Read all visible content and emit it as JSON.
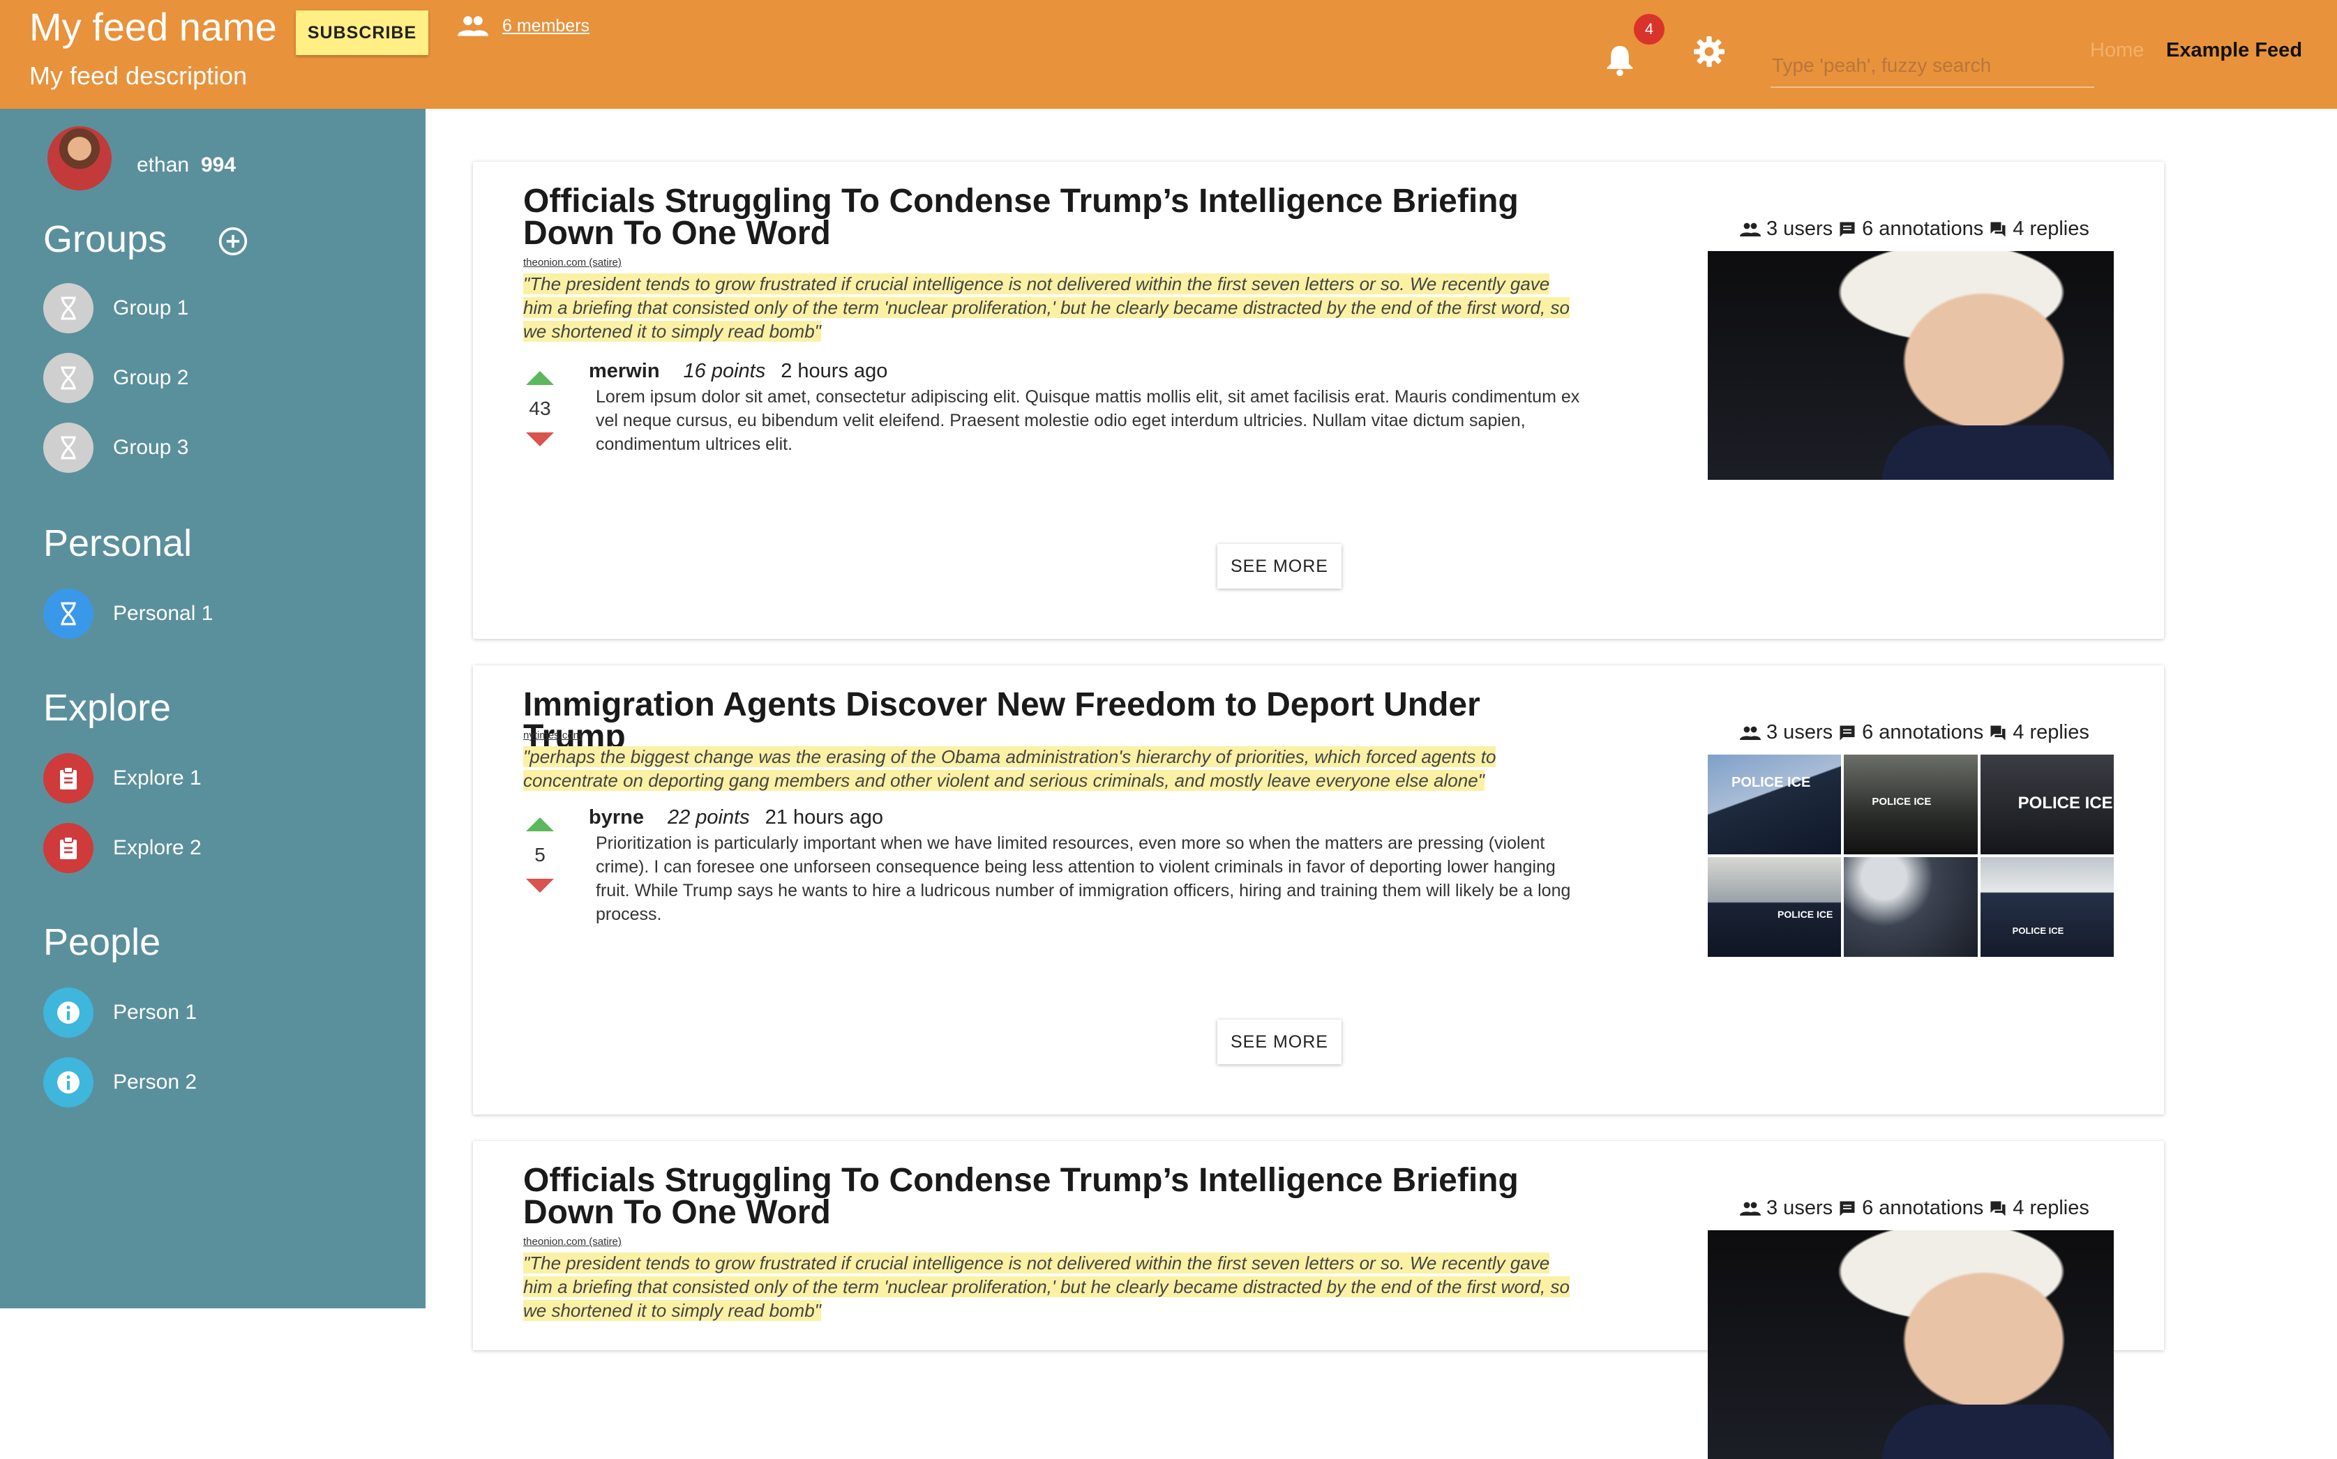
{
  "header": {
    "feed_name": "My feed name",
    "feed_description": "My feed description",
    "subscribe_label": "SUBSCRIBE",
    "members_label": "6 members",
    "notification_count": "4",
    "search_placeholder": "Type 'peah', fuzzy search",
    "home_label": "Home",
    "feed_label": "Example Feed"
  },
  "sidebar": {
    "user": {
      "name": "ethan",
      "score": "994"
    },
    "groups_title": "Groups",
    "groups": [
      "Group 1",
      "Group 2",
      "Group 3"
    ],
    "personal_title": "Personal",
    "personal": [
      "Personal 1"
    ],
    "explore_title": "Explore",
    "explore": [
      "Explore 1",
      "Explore 2"
    ],
    "people_title": "People",
    "people": [
      "Person 1",
      "Person 2"
    ]
  },
  "posts": [
    {
      "title": "Officials Struggling To Condense Trump’s Intelligence Briefing Down To One Word",
      "source": "theonion.com (satire)",
      "quote": "\"The president tends to grow frustrated if crucial intelligence is not delivered within the first seven letters or so. We recently gave him a briefing that consisted only of the term 'nuclear proliferation,' but he clearly became distracted by the end of the first word, so we shortened it to simply read bomb\"",
      "votes": "43",
      "author": "merwin",
      "points": "16 points",
      "time": "2 hours ago",
      "comment": "Lorem ipsum dolor sit amet, consectetur adipiscing elit. Quisque mattis mollis elit, sit amet facilisis erat. Mauris condimentum ex vel neque cursus, eu bibendum velit eleifend. Praesent molestie odio eget interdum ultricies. Nullam vitae dictum sapien, condimentum ultrices elit.",
      "see_more": "SEE MORE",
      "users": "3 users",
      "annotations": "6 annotations",
      "replies": "4 replies"
    },
    {
      "title": "Immigration Agents Discover New Freedom to Deport Under Trump",
      "source": "nytimes.com",
      "quote": "\"perhaps the biggest change was the erasing of the Obama administration's hierarchy of priorities, which forced agents to concentrate on deporting gang members and other violent and serious criminals, and mostly leave everyone else alone\"",
      "votes": "5",
      "author": "byrne",
      "points": "22 points",
      "time": "21 hours ago",
      "comment": "Prioritization is particularly important when we have limited resources, even more so when the matters are pressing (violent crime). I can foresee one unforseen consequence being less attention to violent criminals in favor of deporting lower hanging fruit. While Trump says he wants to hire a ludricous number of immigration officers, hiring and training them will likely be a long process.",
      "see_more": "SEE MORE",
      "users": "3 users",
      "annotations": "6 annotations",
      "replies": "4 replies",
      "photo_labels": [
        "POLICE ICE",
        "POLICE ICE",
        "POLICE ICE",
        "POLICE ICE",
        "",
        "POLICE ICE"
      ]
    },
    {
      "title": "Officials Struggling To Condense Trump’s Intelligence Briefing Down To One Word",
      "source": "theonion.com (satire)",
      "quote": "\"The president tends to grow frustrated if crucial intelligence is not delivered within the first seven letters or so. We recently gave him a briefing that consisted only of the term 'nuclear proliferation,' but he clearly became distracted by the end of the first word, so we shortened it to simply read bomb\"",
      "users": "3 users",
      "annotations": "6 annotations",
      "replies": "4 replies"
    }
  ],
  "colors": {
    "header": "#e8923c",
    "sidebar": "#5a909c",
    "subscribe": "#ffef85",
    "badge": "#d9342b",
    "highlight": "#fbf1a5",
    "upvote": "#5cb85c",
    "downvote": "#d9534f"
  },
  "icons": [
    "people-icon",
    "bell-icon",
    "gear-icon",
    "add-circle-icon",
    "hourglass-icon",
    "clipboard-icon",
    "info-icon",
    "arrow-up-icon",
    "arrow-down-icon",
    "comment-icon",
    "forum-icon"
  ]
}
